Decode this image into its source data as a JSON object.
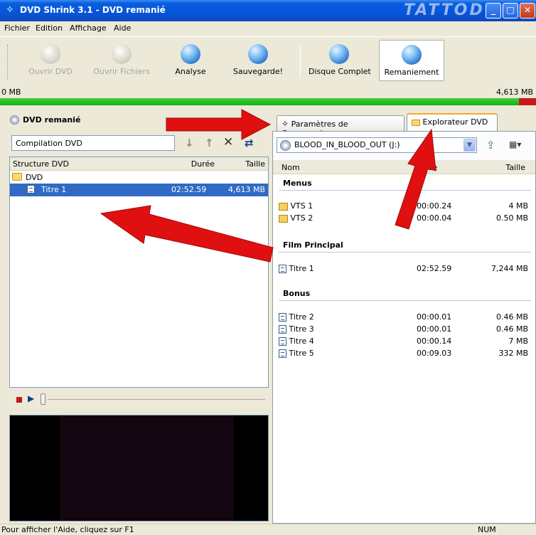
{
  "window": {
    "title": "DVD Shrink 3.1 - DVD remanié",
    "brand_watermark": "TATTOD"
  },
  "menu": [
    "Fichier",
    "Edition",
    "Affichage",
    "Aide"
  ],
  "toolbar": {
    "open_dvd": "Ouvrir DVD",
    "open_files": "Ouvrir Fichiers",
    "analyse": "Analyse",
    "backup": "Sauvegarde!",
    "full_disc": "Disque Complet",
    "reauthor": "Remaniement"
  },
  "size_bar": {
    "left_label": "0 MB",
    "right_label": "4,613 MB",
    "fill_fraction": 0.968
  },
  "left_pane": {
    "title": "DVD remanié",
    "compilation_value": "Compilation DVD",
    "columns": {
      "structure": "Structure DVD",
      "duration": "Durée",
      "size": "Taille"
    },
    "root": "DVD",
    "rows": [
      {
        "name": "Titre 1",
        "duration": "02:52.59",
        "size": "4,613 MB"
      }
    ]
  },
  "right_pane": {
    "tabs": {
      "compression": "Paramètres de Compression",
      "explorer": "Explorateur DVD"
    },
    "drive": "BLOOD_IN_BLOOD_OUT (J:)",
    "columns": {
      "name": "Nom",
      "duration": "Durée",
      "size": "Taille"
    },
    "groups": {
      "menus": {
        "label": "Menus",
        "rows": [
          {
            "name": "VTS 1",
            "duration": "00:00.24",
            "size": "4 MB"
          },
          {
            "name": "VTS 2",
            "duration": "00:00.04",
            "size": "0.50 MB"
          }
        ]
      },
      "main": {
        "label": "Film Principal",
        "rows": [
          {
            "name": "Titre 1",
            "duration": "02:52.59",
            "size": "7,244 MB"
          }
        ]
      },
      "bonus": {
        "label": "Bonus",
        "rows": [
          {
            "name": "Titre 2",
            "duration": "00:00.01",
            "size": "0.46 MB"
          },
          {
            "name": "Titre 3",
            "duration": "00:00.01",
            "size": "0.46 MB"
          },
          {
            "name": "Titre 4",
            "duration": "00:00.14",
            "size": "7 MB"
          },
          {
            "name": "Titre 5",
            "duration": "00:09.03",
            "size": "332 MB"
          }
        ]
      }
    }
  },
  "status": {
    "help": "Pour afficher l'Aide, cliquez sur F1",
    "num": "NUM"
  },
  "colors": {
    "accent": "#316ac5",
    "annotation_arrow": "#e01010",
    "progress_green": "#10b010",
    "progress_over": "#c81818"
  }
}
